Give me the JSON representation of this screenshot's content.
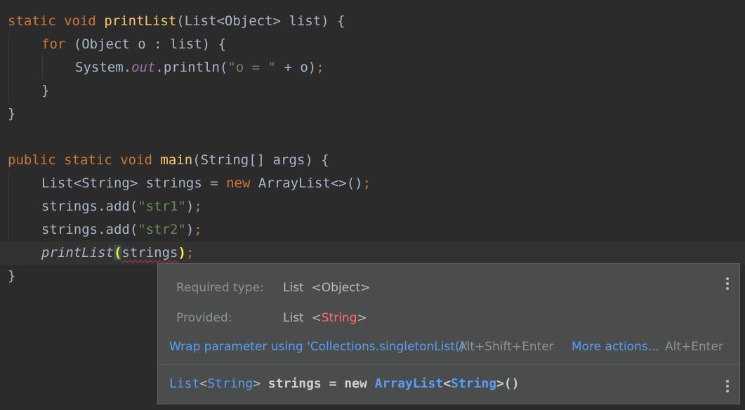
{
  "code": {
    "l1": {
      "kw1": "static",
      "kw2": "void",
      "fn": "printList",
      "rest": "(List<Object> list) {"
    },
    "l2": {
      "kw": "for",
      "rest": " (Object o : list) {"
    },
    "l3": {
      "a": "System.",
      "field": "out",
      "b": ".println(",
      "str": "\"o = \"",
      "c": " + o)",
      "semi": ";"
    },
    "l4": "}",
    "l5": "}",
    "l7": {
      "kw1": "public",
      "kw2": "static",
      "kw3": "void",
      "fn": "main",
      "rest": "(String[] args) {"
    },
    "l8": {
      "a": "List<String> strings = ",
      "kw": "new",
      "b": " ArrayList<>()",
      "semi": ";"
    },
    "l9": {
      "a": "strings.add(",
      "str": "\"str1\"",
      "b": ")",
      "semi": ";"
    },
    "l10": {
      "a": "strings.add(",
      "str": "\"str2\"",
      "b": ")",
      "semi": ";"
    },
    "l11": {
      "fn": "printList",
      "open": "(",
      "arg": "strings",
      "close": ")",
      "semi": ";"
    },
    "l12": "}"
  },
  "popup": {
    "required_label": "Required type:",
    "required_type": "List",
    "required_lt": "<",
    "required_param": "Object",
    "required_gt": ">",
    "provided_label": "Provided:",
    "provided_type": "List",
    "provided_lt": "<",
    "provided_param": "String",
    "provided_gt": ">",
    "fix_action": "Wrap parameter using 'Collections.singletonList()'",
    "fix_shortcut": "Alt+Shift+Enter",
    "more_actions": "More actions...",
    "more_shortcut": "Alt+Enter",
    "decl": {
      "type": "List",
      "lt": "<",
      "param": "String",
      "gt": ">",
      "name": " strings = new ",
      "ctor": "ArrayList",
      "lt2": "<",
      "param2": "String",
      "gt2": ">()"
    }
  }
}
